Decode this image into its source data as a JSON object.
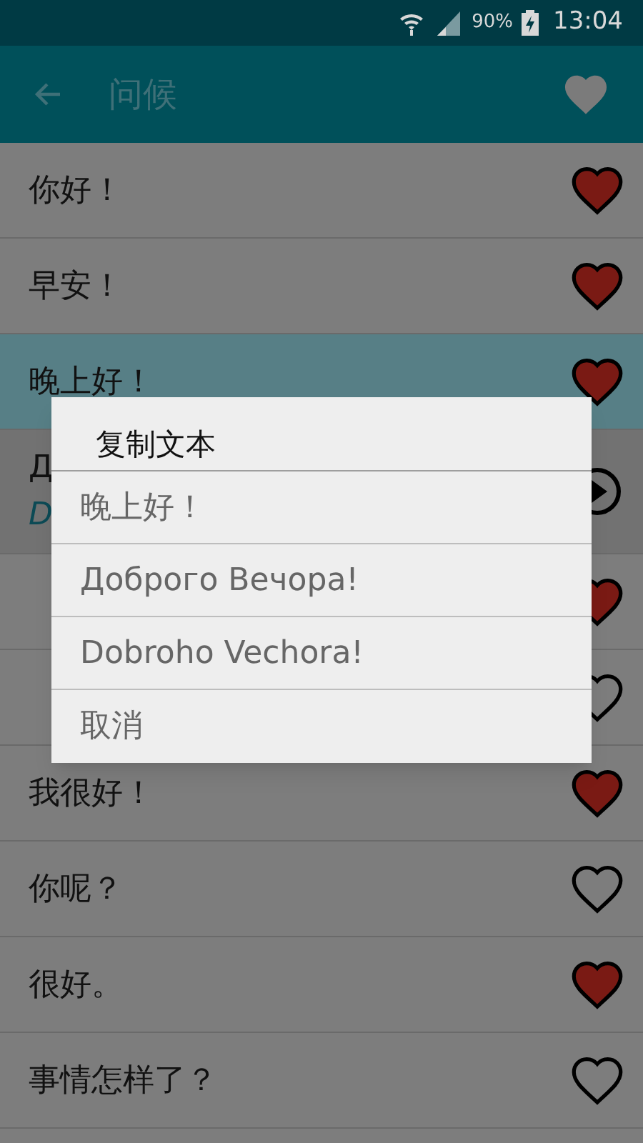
{
  "status_bar": {
    "battery": "90%",
    "time": "13:04"
  },
  "app_bar": {
    "title": "问候"
  },
  "rows": [
    {
      "kind": "phrase",
      "text": "你好！",
      "favorite": true,
      "selected": false
    },
    {
      "kind": "phrase",
      "text": "早安！",
      "favorite": true,
      "selected": false
    },
    {
      "kind": "phrase",
      "text": "晚上好！",
      "favorite": true,
      "selected": true
    },
    {
      "kind": "expanded",
      "text": "Д",
      "transliteration": "D",
      "selected": false
    },
    {
      "kind": "phrase",
      "favorite": true,
      "selected": false
    },
    {
      "kind": "phrase",
      "favorite": false,
      "selected": false
    },
    {
      "kind": "phrase",
      "text": "我很好！",
      "favorite": true,
      "selected": false
    },
    {
      "kind": "phrase",
      "text": "你呢？",
      "favorite": false,
      "selected": false
    },
    {
      "kind": "phrase",
      "text": "很好。",
      "favorite": true,
      "selected": false
    },
    {
      "kind": "phrase",
      "text": "事情怎样了？",
      "favorite": false,
      "selected": false
    }
  ],
  "dialog": {
    "title": "复制文本",
    "items": [
      "晚上好！",
      "Доброго Вечора!",
      "Dobroho Vechora!",
      "取消"
    ]
  }
}
